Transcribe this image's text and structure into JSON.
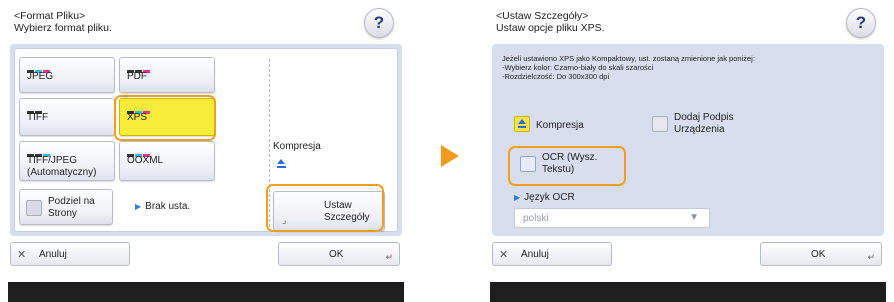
{
  "left": {
    "header_line1": "<Format Pliku>",
    "header_line2": "Wybierz format pliku.",
    "help_label": "?",
    "formats": [
      {
        "label": "JPEG"
      },
      {
        "label": "PDF"
      },
      {
        "label": "TIFF"
      },
      {
        "label": "XPS"
      },
      {
        "label": "TIFF/JPEG (Automatyczny)"
      },
      {
        "label": "OOXML"
      }
    ],
    "divide_button": "Podziel na Strony",
    "divide_status": "Brak usta.",
    "compression_label": "Kompresja",
    "details_button": "Ustaw Szczegóły",
    "cancel_label": "Anuluj",
    "ok_label": "OK"
  },
  "right": {
    "header_line1": "<Ustaw Szczegóły>",
    "header_line2": "Ustaw opcje pliku XPS.",
    "help_label": "?",
    "info_line1": "Jeżeli ustawiono XPS jako Kompaktowy, ust. zostaną zmienione jak poniżej:",
    "info_line2": "-Wybierz kolor: Czarno-biały do skali szarości",
    "info_line3": "-Rozdzielczość: Do 300x300 dpi",
    "compression_button": "Kompresja",
    "signature_button": "Dodaj Podpis Urządzenia",
    "ocr_button": "OCR (Wysz. Tekstu)",
    "ocr_language_label": "Język OCR",
    "ocr_language_value": "polski",
    "cancel_label": "Anuluj",
    "ok_label": "OK"
  },
  "colors": {
    "selected": "#f7ec38",
    "highlight": "#f0a020",
    "arrow": "#f49a1e",
    "panel": "#d8deee"
  }
}
